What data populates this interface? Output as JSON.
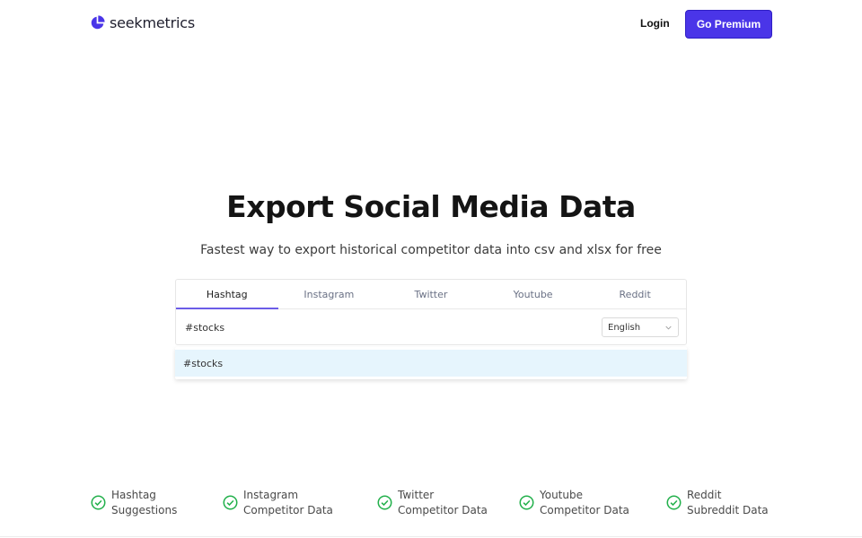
{
  "brand": {
    "name": "seekmetrics",
    "accent": "#4a35e8"
  },
  "nav": {
    "login": "Login",
    "premium": "Go Premium"
  },
  "hero": {
    "title": "Export Social Media Data",
    "subtitle": "Fastest way to export historical competitor data into csv and xlsx for free"
  },
  "search": {
    "tabs": [
      {
        "label": "Hashtag",
        "active": true
      },
      {
        "label": "Instagram",
        "active": false
      },
      {
        "label": "Twitter",
        "active": false
      },
      {
        "label": "Youtube",
        "active": false
      },
      {
        "label": "Reddit",
        "active": false
      }
    ],
    "value": "#stocks",
    "language": "English",
    "suggestions": [
      "#stocks"
    ],
    "active_tab_color": "#6b5ce7"
  },
  "features": [
    {
      "line1": "Hashtag",
      "line2": "Suggestions",
      "icon": "check-circle-icon"
    },
    {
      "line1": "Instagram",
      "line2": "Competitor Data",
      "icon": "check-circle-icon"
    },
    {
      "line1": "Twitter",
      "line2": "Competitor Data",
      "icon": "check-circle-icon"
    },
    {
      "line1": "Youtube",
      "line2": "Competitor Data",
      "icon": "check-circle-icon"
    },
    {
      "line1": "Reddit",
      "line2": "Subreddit Data",
      "icon": "check-circle-icon"
    }
  ],
  "colors": {
    "check": "#22b04b",
    "suggestion_bg": "#e6f5fd"
  }
}
